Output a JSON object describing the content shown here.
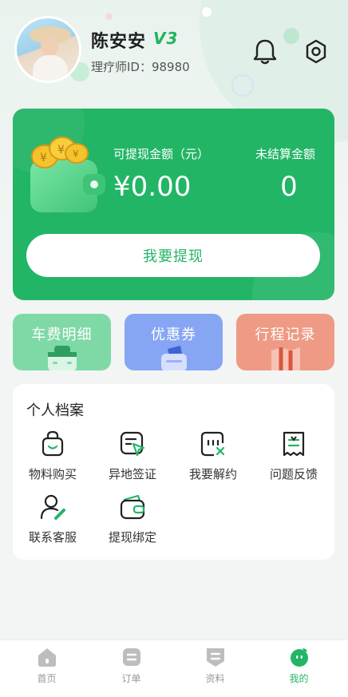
{
  "header": {
    "name": "陈安安",
    "vip_badge": "V3",
    "therapist_id": "理疗师ID：98980",
    "icons": [
      "bell-icon",
      "settings-icon"
    ]
  },
  "wallet": {
    "available_label": "可提现金额（元）",
    "available_amount": "¥0.00",
    "unsettled_label": "未结算金额",
    "unsettled_amount": "0",
    "withdraw_button": "我要提现",
    "accent_color": "#22b566"
  },
  "quick_cards": [
    {
      "label": "车费明细",
      "icon": "car-icon",
      "color": "#7fd9a6"
    },
    {
      "label": "优惠券",
      "icon": "coupon-icon",
      "color": "#86a6f4"
    },
    {
      "label": "行程记录",
      "icon": "itinerary-icon",
      "color": "#ee9a84"
    }
  ],
  "profile": {
    "title": "个人档案",
    "items": [
      {
        "label": "物料购买",
        "icon": "shopping-bag-icon"
      },
      {
        "label": "异地签证",
        "icon": "sign-pointer-icon"
      },
      {
        "label": "我要解约",
        "icon": "terminate-icon"
      },
      {
        "label": "问题反馈",
        "icon": "feedback-receipt-icon"
      },
      {
        "label": "联系客服",
        "icon": "customer-service-icon"
      },
      {
        "label": "提现绑定",
        "icon": "wallet-bind-icon"
      }
    ]
  },
  "bottom_nav": {
    "items": [
      {
        "label": "首页",
        "icon": "home-icon",
        "active": false
      },
      {
        "label": "订单",
        "icon": "order-icon",
        "active": false
      },
      {
        "label": "资料",
        "icon": "profile-doc-icon",
        "active": false
      },
      {
        "label": "我的",
        "icon": "mine-icon",
        "active": true
      }
    ],
    "active_color": "#22b566",
    "inactive_color": "#999999"
  }
}
